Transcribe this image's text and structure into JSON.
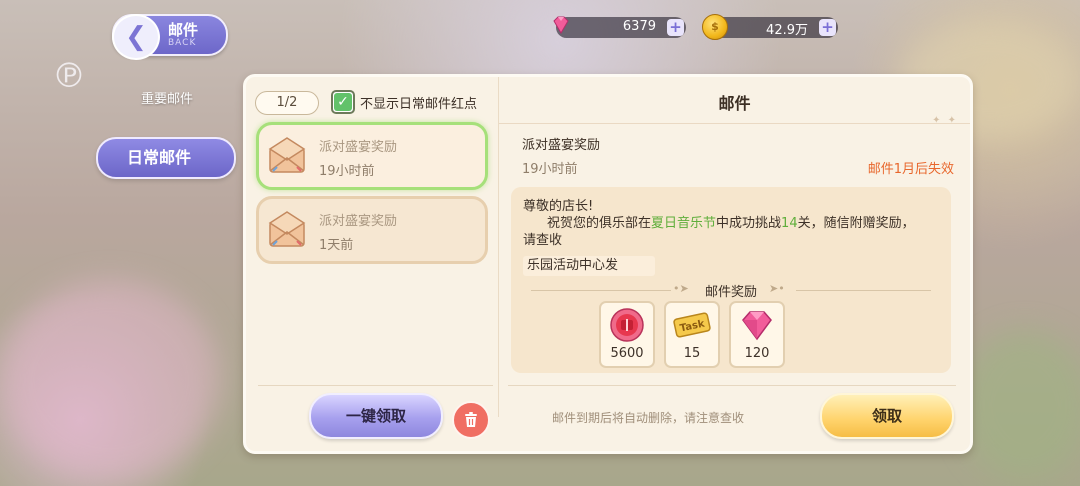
{
  "back": {
    "title": "邮件",
    "subtitle": "BACK"
  },
  "sidebar": {
    "tabs": [
      {
        "label": "重要邮件",
        "active": false
      },
      {
        "label": "日常邮件",
        "active": true
      }
    ]
  },
  "currency": {
    "gems": {
      "value": "6379",
      "icon": "pink-gem-icon"
    },
    "coins": {
      "value": "42.9万",
      "icon": "gold-coin-icon"
    }
  },
  "mail_list": {
    "page": "1/2",
    "hide_red_dot": {
      "label": "不显示日常邮件红点",
      "checked": true
    },
    "items": [
      {
        "title": "派对盛宴奖励",
        "time": "19小时前",
        "selected": true
      },
      {
        "title": "派对盛宴奖励",
        "time": "1天前",
        "selected": false
      }
    ],
    "claim_all_label": "一键领取"
  },
  "detail": {
    "header": "邮件",
    "title": "派对盛宴奖励",
    "time": "19小时前",
    "expire": "邮件1月后失效",
    "greeting": "尊敬的店长!",
    "body_prefix": "祝贺您的俱乐部在",
    "body_event": "夏日音乐节",
    "body_middle": "中成功挑战",
    "body_stage": "14",
    "body_suffix": "关，随信附赠奖励，",
    "body_line3": "请查收",
    "sender": "乐园活动中心发",
    "rewards_label": "邮件奖励",
    "rewards": [
      {
        "icon": "red-gift-coin-icon",
        "qty": "5600"
      },
      {
        "icon": "task-ticket-icon",
        "qty": "15",
        "ticket_text": "Task"
      },
      {
        "icon": "pink-gem-icon",
        "qty": "120"
      }
    ],
    "hint": "邮件到期后将自动删除，请注意查收",
    "claim_label": "领取"
  },
  "colors": {
    "accent_purple": "#7c74d4",
    "selected_border": "#a6e07a",
    "expire_text": "#e8672c",
    "highlight_green": "#5fae3b",
    "claim_yellow": "#ffd36b"
  }
}
